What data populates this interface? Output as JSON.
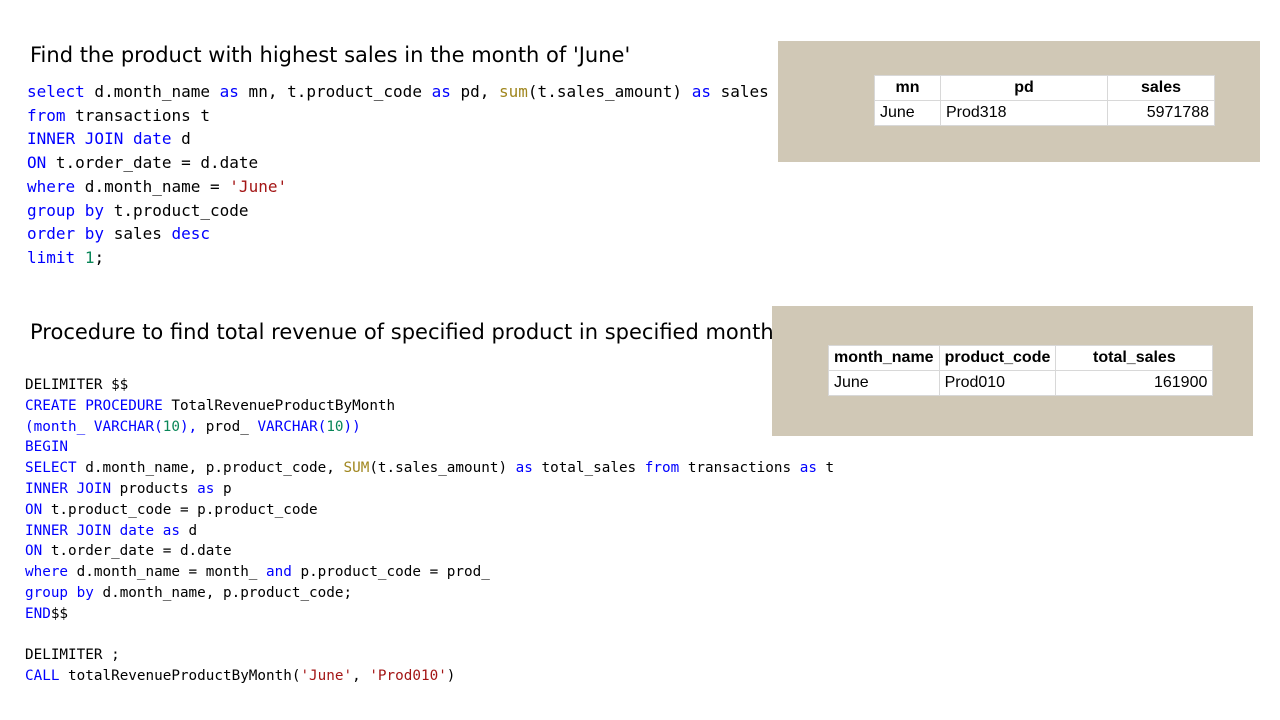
{
  "section1": {
    "heading": "Find the product with highest sales in the month of 'June'",
    "result": {
      "columns": [
        "mn",
        "pd",
        "sales"
      ],
      "rows": [
        [
          "June",
          "Prod318",
          "5971788"
        ]
      ]
    }
  },
  "section2": {
    "heading": "Procedure to find total revenue of specified product in specified month",
    "result": {
      "columns": [
        "month_name",
        "product_code",
        "total_sales"
      ],
      "rows": [
        [
          "June",
          "Prod010",
          "161900"
        ]
      ]
    }
  },
  "code1": [
    [
      [
        "kw",
        "select"
      ],
      [
        "t",
        " d.month_name "
      ],
      [
        "kw",
        "as"
      ],
      [
        "t",
        " mn, t.product_code "
      ],
      [
        "kw",
        "as"
      ],
      [
        "t",
        " pd, "
      ],
      [
        "fn",
        "sum"
      ],
      [
        "t",
        "(t.sales_amount) "
      ],
      [
        "kw",
        "as"
      ],
      [
        "t",
        " sales"
      ]
    ],
    [
      [
        "kw",
        "from"
      ],
      [
        "t",
        " transactions t"
      ]
    ],
    [
      [
        "kw",
        "INNER JOIN date"
      ],
      [
        "t",
        " d"
      ]
    ],
    [
      [
        "kw",
        "ON"
      ],
      [
        "t",
        " t.order_date = d.date"
      ]
    ],
    [
      [
        "kw",
        "where"
      ],
      [
        "t",
        " d.month_name = "
      ],
      [
        "str",
        "'June'"
      ]
    ],
    [
      [
        "kw",
        "group by"
      ],
      [
        "t",
        " t.product_code"
      ]
    ],
    [
      [
        "kw",
        "order by"
      ],
      [
        "t",
        " sales "
      ],
      [
        "kw",
        "desc"
      ]
    ],
    [
      [
        "kw",
        "limit"
      ],
      [
        "t",
        " "
      ],
      [
        "num",
        "1"
      ],
      [
        "t",
        ";"
      ]
    ]
  ],
  "code2": [
    [
      [
        "t",
        "DELIMITER $$"
      ]
    ],
    [
      [
        "kw",
        "CREATE PROCEDURE"
      ],
      [
        "t",
        " TotalRevenueProductByMonth"
      ]
    ],
    [
      [
        "kw",
        "(month_ VARCHAR("
      ],
      [
        "num",
        "10"
      ],
      [
        "kw",
        "),"
      ],
      [
        "t",
        " prod_ "
      ],
      [
        "kw",
        "VARCHAR("
      ],
      [
        "num",
        "10"
      ],
      [
        "kw",
        "))"
      ]
    ],
    [
      [
        "kw",
        "BEGIN"
      ]
    ],
    [
      [
        "kw",
        "SELECT"
      ],
      [
        "t",
        " d.month_name, p.product_code, "
      ],
      [
        "fn",
        "SUM"
      ],
      [
        "t",
        "(t.sales_amount) "
      ],
      [
        "kw",
        "as"
      ],
      [
        "t",
        " total_sales "
      ],
      [
        "kw",
        "from"
      ],
      [
        "t",
        " transactions "
      ],
      [
        "kw",
        "as"
      ],
      [
        "t",
        " t"
      ]
    ],
    [
      [
        "kw",
        "INNER JOIN"
      ],
      [
        "t",
        " products "
      ],
      [
        "kw",
        "as"
      ],
      [
        "t",
        " p"
      ]
    ],
    [
      [
        "kw",
        "ON"
      ],
      [
        "t",
        " t.product_code = p.product_code"
      ]
    ],
    [
      [
        "kw",
        "INNER JOIN date as"
      ],
      [
        "t",
        " d"
      ]
    ],
    [
      [
        "kw",
        "ON"
      ],
      [
        "t",
        " t.order_date = d.date"
      ]
    ],
    [
      [
        "kw",
        "where"
      ],
      [
        "t",
        " d.month_name = month_ "
      ],
      [
        "kw",
        "and"
      ],
      [
        "t",
        " p.product_code = prod_"
      ]
    ],
    [
      [
        "kw",
        "group by"
      ],
      [
        "t",
        " d.month_name, p.product_code;"
      ]
    ],
    [
      [
        "kw",
        "END"
      ],
      [
        "t",
        "$$"
      ]
    ],
    [
      [
        "t",
        ""
      ]
    ],
    [
      [
        "t",
        "DELIMITER ;"
      ]
    ],
    [
      [
        "kw",
        "CALL"
      ],
      [
        "t",
        " totalRevenueProductByMonth("
      ],
      [
        "str",
        "'June'"
      ],
      [
        "t",
        ", "
      ],
      [
        "str",
        "'Prod010'"
      ],
      [
        "t",
        ")"
      ]
    ]
  ]
}
